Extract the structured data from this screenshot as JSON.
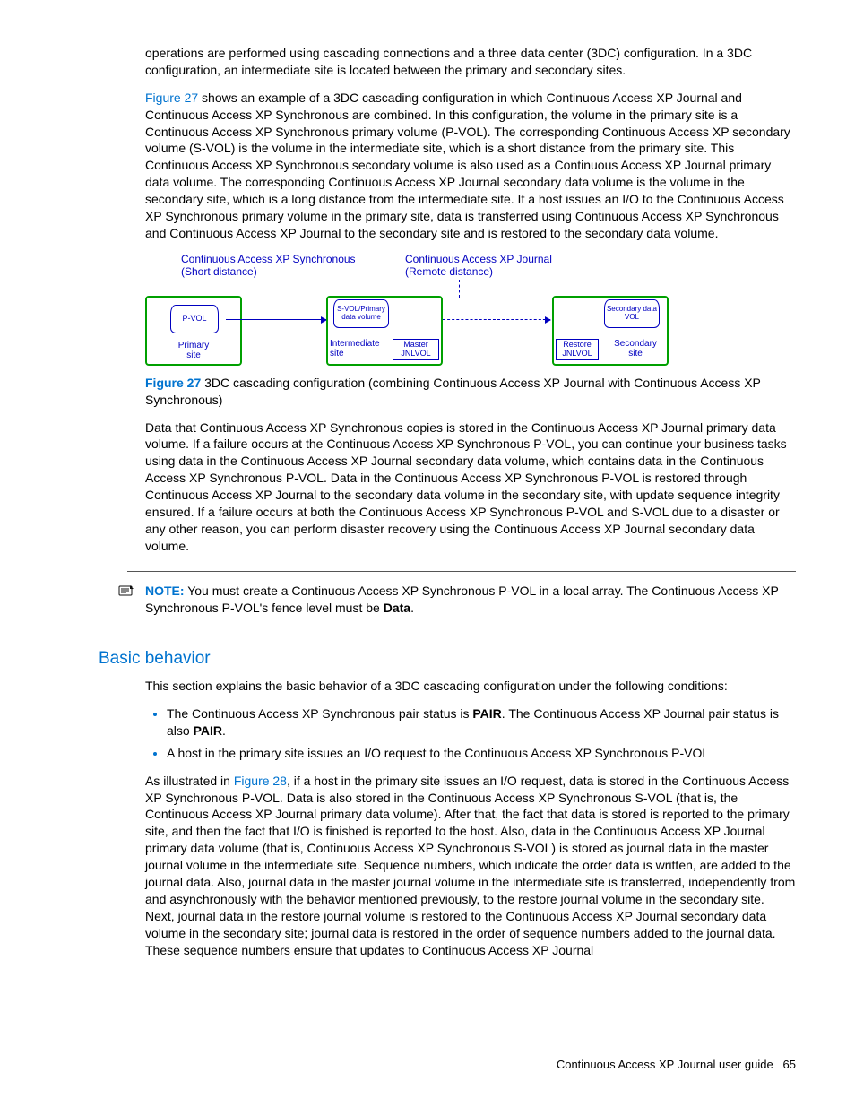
{
  "para1": "operations are performed using cascading connections and a three data center (3DC) configuration. In a 3DC configuration, an intermediate site is located between the primary and secondary sites.",
  "fig27_link": "Figure 27",
  "para2_rest": " shows an example of a 3DC cascading configuration in which Continuous Access XP Journal and Continuous Access XP Synchronous are combined. In this configuration, the volume in the primary site is a Continuous Access XP Synchronous primary volume (P-VOL). The corresponding Continuous Access XP secondary volume (S-VOL) is the volume in the intermediate site, which is a short distance from the primary site. This Continuous Access XP Synchronous secondary volume is also used as a Continuous Access XP Journal primary data volume. The corresponding Continuous Access XP Journal secondary data volume is the volume in the secondary site, which is a long distance from the intermediate site. If a host issues an I/O to the Continuous Access XP Synchronous primary volume in the primary site, data is transferred using Continuous Access XP Synchronous and Continuous Access XP Journal to the secondary site and is restored to the secondary data volume.",
  "diagram": {
    "left_label_l1": "Continuous Access XP Synchronous",
    "left_label_l2": "(Short distance)",
    "right_label_l1": "Continuous Access XP Journal",
    "right_label_l2": "(Remote distance)",
    "pvol": "P-VOL",
    "primary_site": "Primary site",
    "svol_primary": "S-VOL/Primary data volume",
    "intermediate": "Intermediate site",
    "master": "Master JNLVOL",
    "secondary_data": "Secondary data VOL",
    "restore": "Restore JNLVOL",
    "secondary_site": "Secondary site"
  },
  "caption": {
    "num": "Figure 27",
    "text": " 3DC cascading configuration (combining Continuous Access XP Journal with Continuous Access XP Synchronous)"
  },
  "para3": "Data that Continuous Access XP Synchronous copies is stored in the Continuous Access XP Journal primary data volume. If a failure occurs at the Continuous Access XP Synchronous P-VOL, you can continue your business tasks using data in the Continuous Access XP Journal secondary data volume, which contains data in the Continuous Access XP Synchronous P-VOL. Data in the Continuous Access XP Synchronous P-VOL is restored through Continuous Access XP Journal to the secondary data volume in the secondary site, with update sequence integrity ensured. If a failure occurs at both the Continuous Access XP Synchronous P-VOL and S-VOL due to a disaster or any other reason, you can perform disaster recovery using the Continuous Access XP Journal secondary data volume.",
  "note": {
    "label": "NOTE:",
    "text_a": " You must create a Continuous Access XP Synchronous P-VOL in a local array. The Continuous Access XP Synchronous P-VOL's fence level must be ",
    "bold": "Data",
    "text_b": "."
  },
  "section_heading": "Basic behavior",
  "para4": "This section explains the basic behavior of a 3DC cascading configuration under the following conditions:",
  "bullets": {
    "b1a": "The Continuous Access XP Synchronous pair status is ",
    "b1bold1": "PAIR",
    "b1b": ". The Continuous Access XP Journal pair status is also ",
    "b1bold2": "PAIR",
    "b1c": ".",
    "b2": "A host in the primary site issues an I/O request to the Continuous Access XP Synchronous P-VOL"
  },
  "para5_a": "As illustrated in ",
  "fig28_link": "Figure 28",
  "para5_b": ", if a host in the primary site issues an I/O request, data is stored in the Continuous Access XP Synchronous P-VOL. Data is also stored in the Continuous Access XP Synchronous S-VOL (that is, the Continuous Access XP Journal primary data volume). After that, the fact that data is stored is reported to the primary site, and then the fact that I/O is finished is reported to the host. Also, data in the Continuous Access XP Journal primary data volume (that is, Continuous Access XP Synchronous S-VOL) is stored as journal data in the master journal volume in the intermediate site. Sequence numbers, which indicate the order data is written, are added to the journal data. Also, journal data in the master journal volume in the intermediate site is transferred, independently from and asynchronously with the behavior mentioned previously, to the restore journal volume in the secondary site. Next, journal data in the restore journal volume is restored to the Continuous Access XP Journal secondary data volume in the secondary site; journal data is restored in the order of sequence numbers added to the journal data. These sequence numbers ensure that updates to Continuous Access XP Journal",
  "footer_text": "Continuous Access XP Journal user guide",
  "page_number": "65"
}
